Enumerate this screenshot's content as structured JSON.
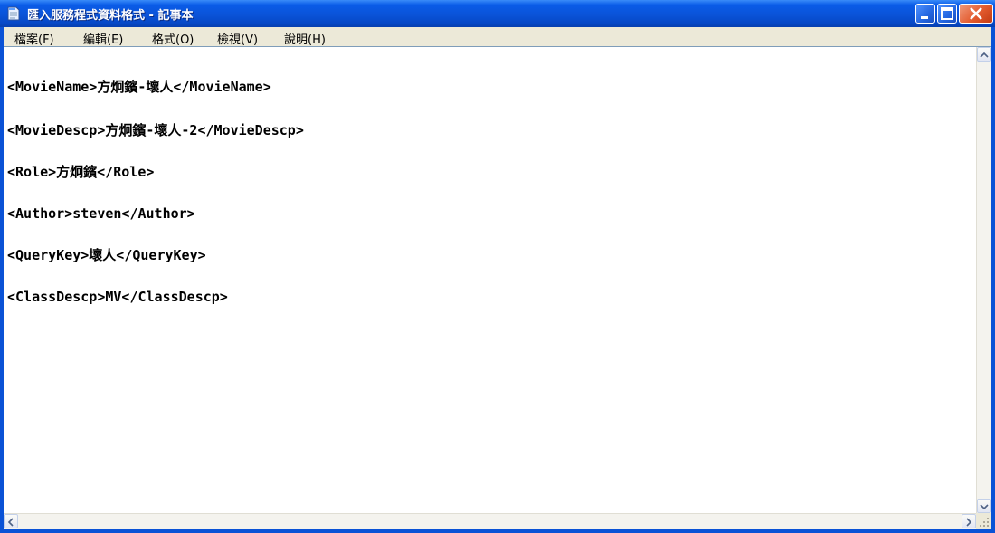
{
  "window": {
    "title": "匯入服務程式資料格式 - 記事本"
  },
  "menu": {
    "items": [
      "檔案(F)",
      "編輯(E)",
      "格式(O)",
      "檢視(V)",
      "說明(H)"
    ]
  },
  "document": {
    "lines": [
      "<MovieName>方炯鑌-壞人</MovieName>",
      "<MovieDescp>方炯鑌-壞人-2</MovieDescp>",
      "<Role>方炯鑌</Role>",
      "<Author>steven</Author>",
      "<QueryKey>壞人</QueryKey>",
      "<ClassDescp>MV</ClassDescp>"
    ]
  },
  "colors": {
    "titlebar": "#0a53d8",
    "close_button": "#e35b2e",
    "menubar": "#ece9d8",
    "editor_bg": "#ffffff"
  },
  "icons": {
    "app": "notepad-icon",
    "minimize": "minimize-icon",
    "maximize": "maximize-icon",
    "close": "close-icon"
  }
}
